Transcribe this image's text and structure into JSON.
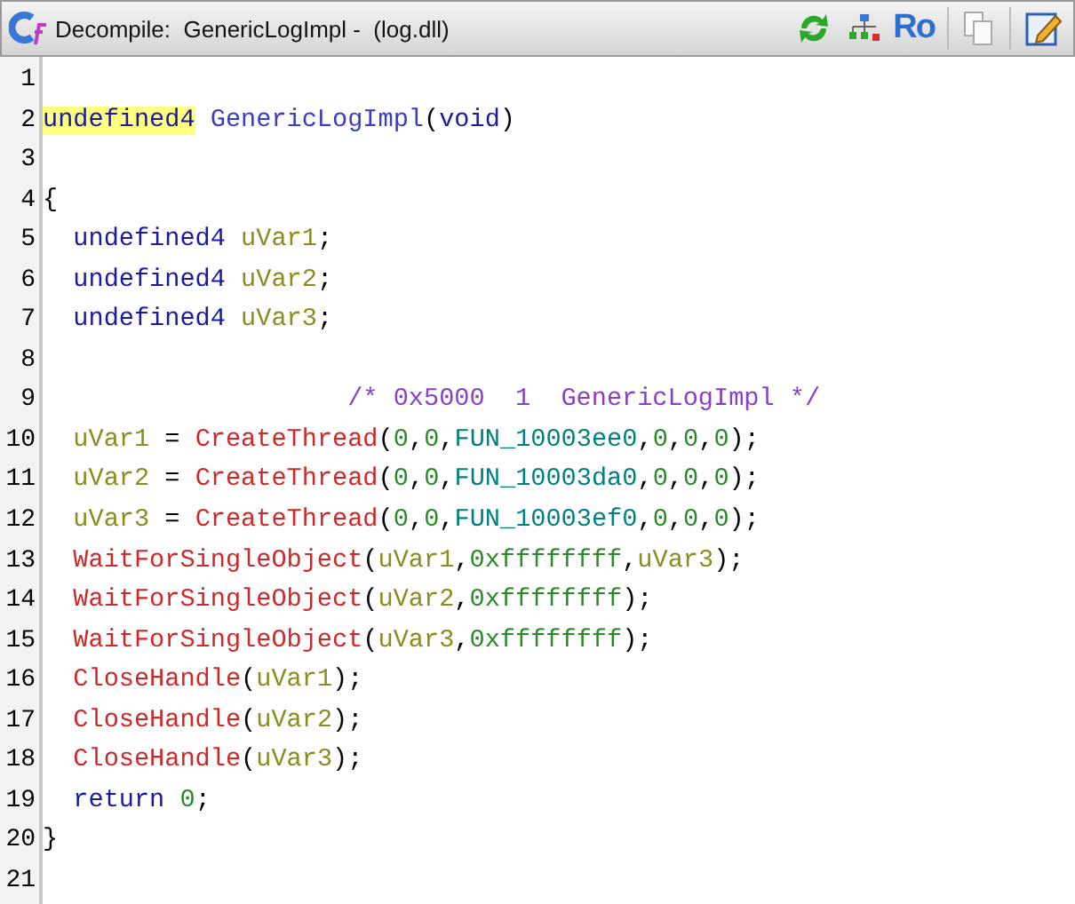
{
  "window": {
    "title": "Decompile:  GenericLogImpl -  (log.dll)"
  },
  "toolbar": {
    "ro_button": "Ro"
  },
  "lines": [
    {
      "number": "1"
    },
    {
      "number": "2",
      "tokens": [
        {
          "text": "undefined4",
          "kind": "type",
          "highlighted": true
        },
        {
          "text": " GenericLogImpl",
          "kind": "fn",
          "highlighted": false
        },
        {
          "text": "(",
          "kind": "plain",
          "highlighted": false
        },
        {
          "text": "void",
          "kind": "type",
          "highlighted": false
        },
        {
          "text": ")",
          "kind": "plain",
          "highlighted": false
        }
      ]
    },
    {
      "number": "3"
    },
    {
      "number": "4",
      "tokens": [
        {
          "text": "{",
          "kind": "plain",
          "highlighted": false
        }
      ]
    },
    {
      "number": "5",
      "tokens": [
        {
          "text": "  undefined4 ",
          "kind": "type",
          "highlighted": false
        },
        {
          "text": "uVar1",
          "kind": "var",
          "highlighted": false
        },
        {
          "text": ";",
          "kind": "plain",
          "highlighted": false
        }
      ]
    },
    {
      "number": "6",
      "tokens": [
        {
          "text": "  undefined4 ",
          "kind": "type",
          "highlighted": false
        },
        {
          "text": "uVar2",
          "kind": "var",
          "highlighted": false
        },
        {
          "text": ";",
          "kind": "plain",
          "highlighted": false
        }
      ]
    },
    {
      "number": "7",
      "tokens": [
        {
          "text": "  undefined4 ",
          "kind": "type",
          "highlighted": false
        },
        {
          "text": "uVar3",
          "kind": "var",
          "highlighted": false
        },
        {
          "text": ";",
          "kind": "plain",
          "highlighted": false
        }
      ]
    },
    {
      "number": "8"
    },
    {
      "number": "9",
      "tokens": [
        {
          "text": "                    /* 0x5000  1  GenericLogImpl */",
          "kind": "comment",
          "highlighted": false
        }
      ]
    },
    {
      "number": "10",
      "tokens": [
        {
          "text": "  uVar1",
          "kind": "var",
          "highlighted": false
        },
        {
          "text": " = ",
          "kind": "plain",
          "highlighted": false
        },
        {
          "text": "CreateThread",
          "kind": "call",
          "highlighted": false
        },
        {
          "text": "(",
          "kind": "plain",
          "highlighted": false
        },
        {
          "text": "0",
          "kind": "number",
          "highlighted": false
        },
        {
          "text": ",",
          "kind": "plain",
          "highlighted": false
        },
        {
          "text": "0",
          "kind": "number",
          "highlighted": false
        },
        {
          "text": ",",
          "kind": "plain",
          "highlighted": false
        },
        {
          "text": "FUN_10003ee0",
          "kind": "ref",
          "highlighted": false
        },
        {
          "text": ",",
          "kind": "plain",
          "highlighted": false
        },
        {
          "text": "0",
          "kind": "number",
          "highlighted": false
        },
        {
          "text": ",",
          "kind": "plain",
          "highlighted": false
        },
        {
          "text": "0",
          "kind": "number",
          "highlighted": false
        },
        {
          "text": ",",
          "kind": "plain",
          "highlighted": false
        },
        {
          "text": "0",
          "kind": "number",
          "highlighted": false
        },
        {
          "text": ");",
          "kind": "plain",
          "highlighted": false
        }
      ]
    },
    {
      "number": "11",
      "tokens": [
        {
          "text": "  uVar2",
          "kind": "var",
          "highlighted": false
        },
        {
          "text": " = ",
          "kind": "plain",
          "highlighted": false
        },
        {
          "text": "CreateThread",
          "kind": "call",
          "highlighted": false
        },
        {
          "text": "(",
          "kind": "plain",
          "highlighted": false
        },
        {
          "text": "0",
          "kind": "number",
          "highlighted": false
        },
        {
          "text": ",",
          "kind": "plain",
          "highlighted": false
        },
        {
          "text": "0",
          "kind": "number",
          "highlighted": false
        },
        {
          "text": ",",
          "kind": "plain",
          "highlighted": false
        },
        {
          "text": "FUN_10003da0",
          "kind": "ref",
          "highlighted": false
        },
        {
          "text": ",",
          "kind": "plain",
          "highlighted": false
        },
        {
          "text": "0",
          "kind": "number",
          "highlighted": false
        },
        {
          "text": ",",
          "kind": "plain",
          "highlighted": false
        },
        {
          "text": "0",
          "kind": "number",
          "highlighted": false
        },
        {
          "text": ",",
          "kind": "plain",
          "highlighted": false
        },
        {
          "text": "0",
          "kind": "number",
          "highlighted": false
        },
        {
          "text": ");",
          "kind": "plain",
          "highlighted": false
        }
      ]
    },
    {
      "number": "12",
      "tokens": [
        {
          "text": "  uVar3",
          "kind": "var",
          "highlighted": false
        },
        {
          "text": " = ",
          "kind": "plain",
          "highlighted": false
        },
        {
          "text": "CreateThread",
          "kind": "call",
          "highlighted": false
        },
        {
          "text": "(",
          "kind": "plain",
          "highlighted": false
        },
        {
          "text": "0",
          "kind": "number",
          "highlighted": false
        },
        {
          "text": ",",
          "kind": "plain",
          "highlighted": false
        },
        {
          "text": "0",
          "kind": "number",
          "highlighted": false
        },
        {
          "text": ",",
          "kind": "plain",
          "highlighted": false
        },
        {
          "text": "FUN_10003ef0",
          "kind": "ref",
          "highlighted": false
        },
        {
          "text": ",",
          "kind": "plain",
          "highlighted": false
        },
        {
          "text": "0",
          "kind": "number",
          "highlighted": false
        },
        {
          "text": ",",
          "kind": "plain",
          "highlighted": false
        },
        {
          "text": "0",
          "kind": "number",
          "highlighted": false
        },
        {
          "text": ",",
          "kind": "plain",
          "highlighted": false
        },
        {
          "text": "0",
          "kind": "number",
          "highlighted": false
        },
        {
          "text": ");",
          "kind": "plain",
          "highlighted": false
        }
      ]
    },
    {
      "number": "13",
      "tokens": [
        {
          "text": "  WaitForSingleObject",
          "kind": "call",
          "highlighted": false
        },
        {
          "text": "(",
          "kind": "plain",
          "highlighted": false
        },
        {
          "text": "uVar1",
          "kind": "var",
          "highlighted": false
        },
        {
          "text": ",",
          "kind": "plain",
          "highlighted": false
        },
        {
          "text": "0xffffffff",
          "kind": "number",
          "highlighted": false
        },
        {
          "text": ",",
          "kind": "plain",
          "highlighted": false
        },
        {
          "text": "uVar3",
          "kind": "var",
          "highlighted": false
        },
        {
          "text": ");",
          "kind": "plain",
          "highlighted": false
        }
      ]
    },
    {
      "number": "14",
      "tokens": [
        {
          "text": "  WaitForSingleObject",
          "kind": "call",
          "highlighted": false
        },
        {
          "text": "(",
          "kind": "plain",
          "highlighted": false
        },
        {
          "text": "uVar2",
          "kind": "var",
          "highlighted": false
        },
        {
          "text": ",",
          "kind": "plain",
          "highlighted": false
        },
        {
          "text": "0xffffffff",
          "kind": "number",
          "highlighted": false
        },
        {
          "text": ");",
          "kind": "plain",
          "highlighted": false
        }
      ]
    },
    {
      "number": "15",
      "tokens": [
        {
          "text": "  WaitForSingleObject",
          "kind": "call",
          "highlighted": false
        },
        {
          "text": "(",
          "kind": "plain",
          "highlighted": false
        },
        {
          "text": "uVar3",
          "kind": "var",
          "highlighted": false
        },
        {
          "text": ",",
          "kind": "plain",
          "highlighted": false
        },
        {
          "text": "0xffffffff",
          "kind": "number",
          "highlighted": false
        },
        {
          "text": ");",
          "kind": "plain",
          "highlighted": false
        }
      ]
    },
    {
      "number": "16",
      "tokens": [
        {
          "text": "  CloseHandle",
          "kind": "call",
          "highlighted": false
        },
        {
          "text": "(",
          "kind": "plain",
          "highlighted": false
        },
        {
          "text": "uVar1",
          "kind": "var",
          "highlighted": false
        },
        {
          "text": ");",
          "kind": "plain",
          "highlighted": false
        }
      ]
    },
    {
      "number": "17",
      "tokens": [
        {
          "text": "  CloseHandle",
          "kind": "call",
          "highlighted": false
        },
        {
          "text": "(",
          "kind": "plain",
          "highlighted": false
        },
        {
          "text": "uVar2",
          "kind": "var",
          "highlighted": false
        },
        {
          "text": ");",
          "kind": "plain",
          "highlighted": false
        }
      ]
    },
    {
      "number": "18",
      "tokens": [
        {
          "text": "  CloseHandle",
          "kind": "call",
          "highlighted": false
        },
        {
          "text": "(",
          "kind": "plain",
          "highlighted": false
        },
        {
          "text": "uVar3",
          "kind": "var",
          "highlighted": false
        },
        {
          "text": ");",
          "kind": "plain",
          "highlighted": false
        }
      ]
    },
    {
      "number": "19",
      "tokens": [
        {
          "text": "  return ",
          "kind": "keyword",
          "highlighted": false
        },
        {
          "text": "0",
          "kind": "number",
          "highlighted": false
        },
        {
          "text": ";",
          "kind": "plain",
          "highlighted": false
        }
      ]
    },
    {
      "number": "20",
      "tokens": [
        {
          "text": "}",
          "kind": "plain",
          "highlighted": false
        }
      ]
    },
    {
      "number": "21"
    }
  ]
}
